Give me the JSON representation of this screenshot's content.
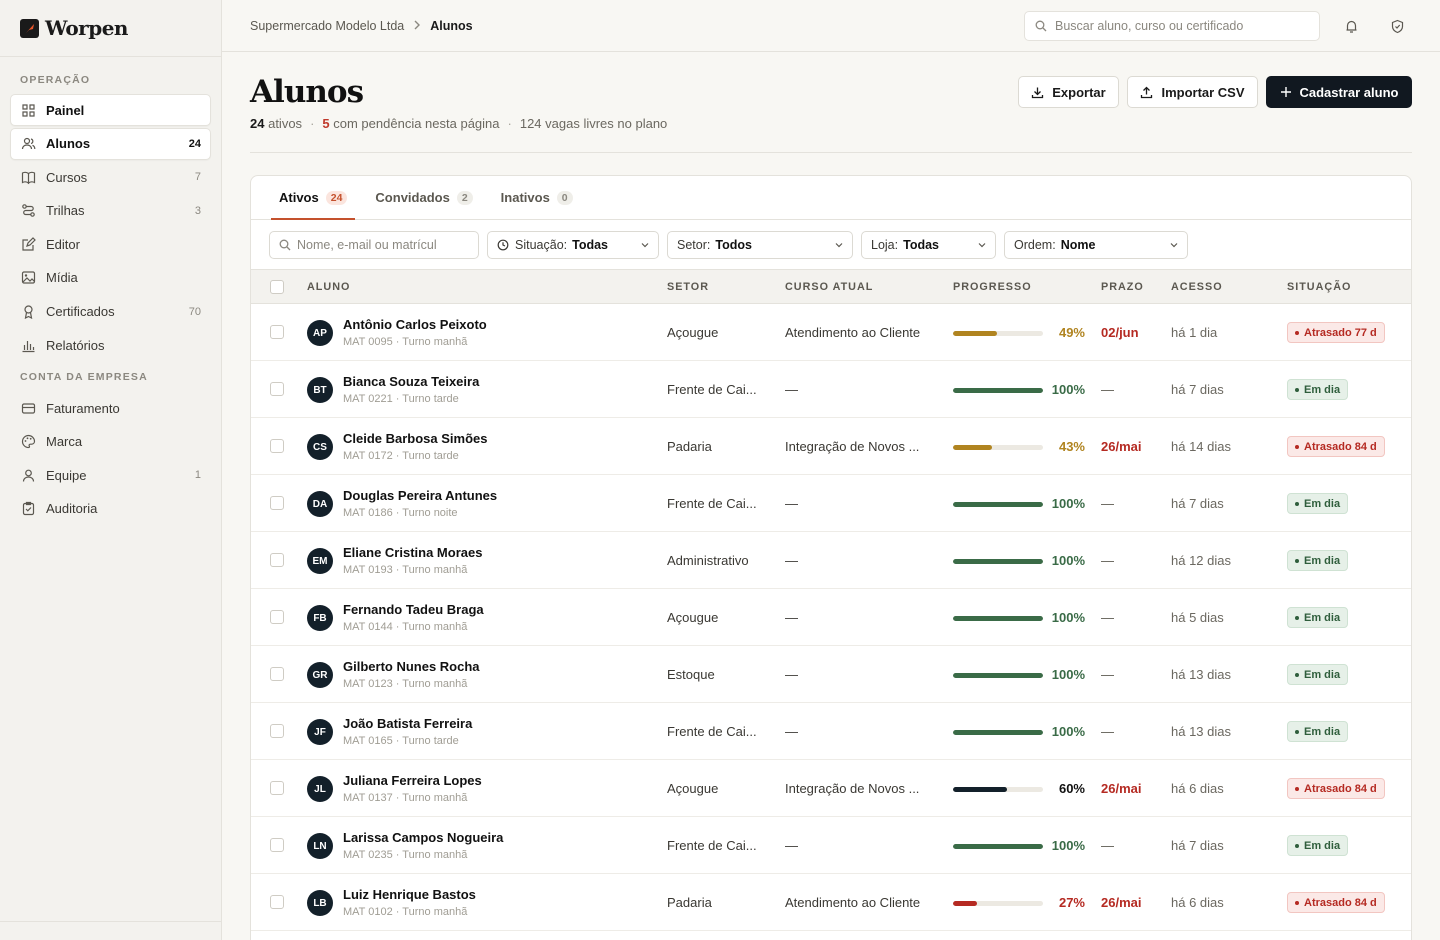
{
  "brand": {
    "name": "Worpen"
  },
  "sidebar": {
    "section1": "OPERAÇÃO",
    "section2": "CONTA DA EMPRESA",
    "items": [
      {
        "label": "Painel",
        "count": "",
        "icon": "grid-icon",
        "active": false,
        "boxed": true
      },
      {
        "label": "Alunos",
        "count": "24",
        "icon": "users-icon",
        "active": true
      },
      {
        "label": "Cursos",
        "count": "7",
        "icon": "book-icon"
      },
      {
        "label": "Trilhas",
        "count": "3",
        "icon": "route-icon"
      },
      {
        "label": "Editor",
        "count": "",
        "icon": "edit-icon"
      },
      {
        "label": "Mídia",
        "count": "",
        "icon": "image-icon"
      },
      {
        "label": "Certificados",
        "count": "70",
        "icon": "award-icon"
      },
      {
        "label": "Relatórios",
        "count": "",
        "icon": "chart-icon"
      }
    ],
    "items2": [
      {
        "label": "Faturamento",
        "count": "",
        "icon": "card-icon"
      },
      {
        "label": "Marca",
        "count": "",
        "icon": "palette-icon"
      },
      {
        "label": "Equipe",
        "count": "1",
        "icon": "user-icon"
      },
      {
        "label": "Auditoria",
        "count": "",
        "icon": "clipboard-icon"
      }
    ]
  },
  "topbar": {
    "breadcrumb_company": "Supermercado Modelo Ltda",
    "breadcrumb_current": "Alunos",
    "search_placeholder": "Buscar aluno, curso ou certificado"
  },
  "header": {
    "title": "Alunos",
    "active_count": "24",
    "active_label": "ativos",
    "pending_count": "5",
    "pending_label": "com pendência nesta página",
    "vacancies": "124 vagas livres no plano",
    "export_label": "Exportar",
    "import_label": "Importar CSV",
    "create_label": "Cadastrar aluno"
  },
  "tabs": [
    {
      "label": "Ativos",
      "count": "24"
    },
    {
      "label": "Convidados",
      "count": "2"
    },
    {
      "label": "Inativos",
      "count": "0"
    }
  ],
  "filters": {
    "search_placeholder": "Nome, e-mail ou matrícul",
    "situacao_label": "Situação:",
    "situacao_value": "Todas",
    "setor_label": "Setor:",
    "setor_value": "Todos",
    "loja_label": "Loja:",
    "loja_value": "Todas",
    "ordem_label": "Ordem:",
    "ordem_value": "Nome"
  },
  "columns": [
    "ALUNO",
    "SETOR",
    "CURSO ATUAL",
    "PROGRESSO",
    "PRAZO",
    "ACESSO",
    "SITUAÇÃO"
  ],
  "colors": {
    "accent": "#c4512d",
    "ok": "#3a6b47",
    "warn": "#b08420",
    "bad": "#b52a22",
    "dark": "#13202a"
  },
  "rows": [
    {
      "initials": "AP",
      "name": "Antônio Carlos Peixoto",
      "meta": "MAT 0095 · Turno manhã",
      "setor": "Açougue",
      "curso": "Atendimento ao Cliente",
      "progress": 49,
      "progress_label": "49%",
      "tone": "warn",
      "prazo": "02/jun",
      "acesso": "há 1 dia",
      "status": "Atrasado 77 d",
      "status_type": "late"
    },
    {
      "initials": "BT",
      "name": "Bianca Souza Teixeira",
      "meta": "MAT 0221 · Turno tarde",
      "setor": "Frente de Cai...",
      "curso": "—",
      "progress": 100,
      "progress_label": "100%",
      "tone": "ok",
      "prazo": "—",
      "acesso": "há 7 dias",
      "status": "Em dia",
      "status_type": "ok"
    },
    {
      "initials": "CS",
      "name": "Cleide Barbosa Simões",
      "meta": "MAT 0172 · Turno tarde",
      "setor": "Padaria",
      "curso": "Integração de Novos ...",
      "progress": 43,
      "progress_label": "43%",
      "tone": "warn",
      "prazo": "26/mai",
      "acesso": "há 14 dias",
      "status": "Atrasado 84 d",
      "status_type": "late"
    },
    {
      "initials": "DA",
      "name": "Douglas Pereira Antunes",
      "meta": "MAT 0186 · Turno noite",
      "setor": "Frente de Cai...",
      "curso": "—",
      "progress": 100,
      "progress_label": "100%",
      "tone": "ok",
      "prazo": "—",
      "acesso": "há 7 dias",
      "status": "Em dia",
      "status_type": "ok"
    },
    {
      "initials": "EM",
      "name": "Eliane Cristina Moraes",
      "meta": "MAT 0193 · Turno manhã",
      "setor": "Administrativo",
      "curso": "—",
      "progress": 100,
      "progress_label": "100%",
      "tone": "ok",
      "prazo": "—",
      "acesso": "há 12 dias",
      "status": "Em dia",
      "status_type": "ok"
    },
    {
      "initials": "FB",
      "name": "Fernando Tadeu Braga",
      "meta": "MAT 0144 · Turno manhã",
      "setor": "Açougue",
      "curso": "—",
      "progress": 100,
      "progress_label": "100%",
      "tone": "ok",
      "prazo": "—",
      "acesso": "há 5 dias",
      "status": "Em dia",
      "status_type": "ok"
    },
    {
      "initials": "GR",
      "name": "Gilberto Nunes Rocha",
      "meta": "MAT 0123 · Turno manhã",
      "setor": "Estoque",
      "curso": "—",
      "progress": 100,
      "progress_label": "100%",
      "tone": "ok",
      "prazo": "—",
      "acesso": "há 13 dias",
      "status": "Em dia",
      "status_type": "ok"
    },
    {
      "initials": "JF",
      "name": "João Batista Ferreira",
      "meta": "MAT 0165 · Turno tarde",
      "setor": "Frente de Cai...",
      "curso": "—",
      "progress": 100,
      "progress_label": "100%",
      "tone": "ok",
      "prazo": "—",
      "acesso": "há 13 dias",
      "status": "Em dia",
      "status_type": "ok"
    },
    {
      "initials": "JL",
      "name": "Juliana Ferreira Lopes",
      "meta": "MAT 0137 · Turno manhã",
      "setor": "Açougue",
      "curso": "Integração de Novos ...",
      "progress": 60,
      "progress_label": "60%",
      "tone": "dark",
      "prazo": "26/mai",
      "acesso": "há 6 dias",
      "status": "Atrasado 84 d",
      "status_type": "late"
    },
    {
      "initials": "LN",
      "name": "Larissa Campos Nogueira",
      "meta": "MAT 0235 · Turno manhã",
      "setor": "Frente de Cai...",
      "curso": "—",
      "progress": 100,
      "progress_label": "100%",
      "tone": "ok",
      "prazo": "—",
      "acesso": "há 7 dias",
      "status": "Em dia",
      "status_type": "ok"
    },
    {
      "initials": "LB",
      "name": "Luiz Henrique Bastos",
      "meta": "MAT 0102 · Turno manhã",
      "setor": "Padaria",
      "curso": "Atendimento ao Cliente",
      "progress": 27,
      "progress_label": "27%",
      "tone": "bad",
      "prazo": "26/mai",
      "acesso": "há 6 dias",
      "status": "Atrasado 84 d",
      "status_type": "late"
    }
  ]
}
